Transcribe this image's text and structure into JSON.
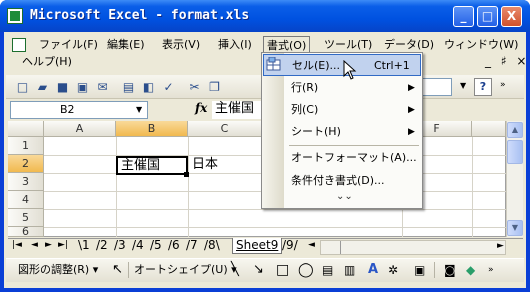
{
  "window": {
    "title": "Microsoft Excel - format.xls",
    "minimize": "_",
    "maximize": "□",
    "close": "X"
  },
  "menubar": {
    "items": [
      "ファイル(F)",
      "編集(E)",
      "表示(V)",
      "挿入(I)",
      "書式(O)",
      "ツール(T)",
      "データ(D)",
      "ウィンドウ(W)"
    ],
    "row2": [
      "ヘルプ(H)"
    ],
    "mdi_controls": "_ ♯ ×"
  },
  "toolbar": {
    "zoom": "00%",
    "help": "?"
  },
  "formula_bar": {
    "name_box": "B2",
    "fx": "fx",
    "content": "主催国"
  },
  "grid": {
    "columns": [
      "A",
      "B",
      "C",
      "F"
    ],
    "rows": [
      "1",
      "2",
      "3",
      "4",
      "5",
      "6"
    ],
    "cells": {
      "B2": "主催国",
      "C2": "日本"
    },
    "selected_column": "B",
    "selected_row": "2"
  },
  "sheet_tabs": {
    "tabs": [
      "1",
      "2",
      "3",
      "4",
      "5",
      "6",
      "7",
      "8"
    ],
    "active": "Sheet9",
    "after": "9"
  },
  "drawing_toolbar": {
    "adjust": "図形の調整(R)",
    "autoshape": "オートシェイプ(U)"
  },
  "format_menu": {
    "items": [
      {
        "label": "セル(E)...",
        "shortcut": "Ctrl+1",
        "highlighted": true
      },
      {
        "label": "行(R)",
        "submenu": true
      },
      {
        "label": "列(C)",
        "submenu": true
      },
      {
        "label": "シート(H)",
        "submenu": true
      },
      {
        "label": "オートフォーマット(A)..."
      },
      {
        "label": "条件付き書式(D)..."
      }
    ],
    "expand": "»"
  },
  "colors": {
    "titlebar": "#0a5ee8",
    "menu_highlight": "#c1d2ee",
    "selection_header": "#f1b94f"
  }
}
